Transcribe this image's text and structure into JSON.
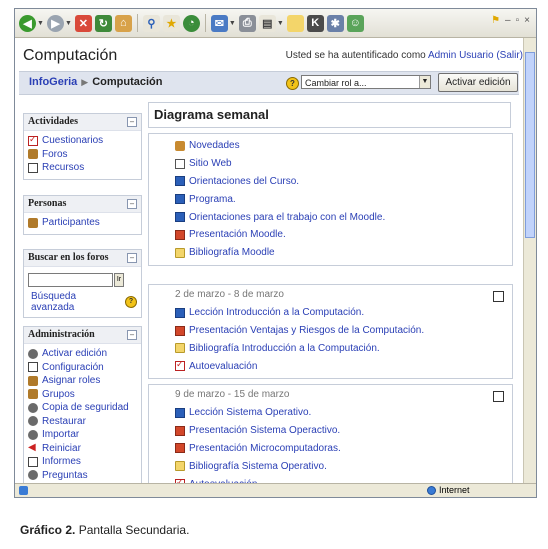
{
  "course": {
    "title": "Computación"
  },
  "login": {
    "prefix": "Usted se ha autentificado como",
    "user": "Admin Usuario",
    "logout": "(Salir)"
  },
  "breadcrumb": {
    "home": "InfoGeria",
    "current": "Computación"
  },
  "role_select": {
    "value": "Cambiar rol a..."
  },
  "edit_button": {
    "label": "Activar edición"
  },
  "blocks": {
    "activities": {
      "title": "Actividades",
      "items": [
        "Cuestionarios",
        "Foros",
        "Recursos"
      ]
    },
    "people": {
      "title": "Personas",
      "items": [
        "Participantes"
      ]
    },
    "search": {
      "title": "Buscar en los foros",
      "go": "Ir",
      "advanced": "Búsqueda avanzada"
    },
    "admin": {
      "title": "Administración",
      "items": [
        "Activar edición",
        "Configuración",
        "Asignar roles",
        "Grupos",
        "Copia de seguridad",
        "Restaurar",
        "Importar",
        "Reiniciar",
        "Informes",
        "Preguntas"
      ]
    }
  },
  "main": {
    "title": "Diagrama semanal",
    "sections": [
      {
        "date": "",
        "items": [
          {
            "icon": "news-icon",
            "label": "Novedades"
          },
          {
            "icon": "web-icon",
            "label": "Sitio Web"
          },
          {
            "icon": "word-icon",
            "label": "Orientaciones del Curso."
          },
          {
            "icon": "word-icon",
            "label": "Programa."
          },
          {
            "icon": "word-icon",
            "label": "Orientaciones para el trabajo con el Moodle."
          },
          {
            "icon": "ppt-icon",
            "label": "Presentación Moodle."
          },
          {
            "icon": "folder-icon",
            "label": "Bibliografía Moodle"
          }
        ]
      },
      {
        "date": "2 de marzo - 8 de marzo",
        "items": [
          {
            "icon": "word-icon",
            "label": "Lección Introducción a la Computación."
          },
          {
            "icon": "ppt-icon",
            "label": "Presentación Ventajas y Riesgos de la Computación."
          },
          {
            "icon": "folder-icon",
            "label": "Bibliografía Introducción a la Computación."
          },
          {
            "icon": "quiz-icon",
            "label": "Autoevaluación"
          }
        ]
      },
      {
        "date": "9 de marzo - 15 de marzo",
        "items": [
          {
            "icon": "word-icon",
            "label": "Lección Sistema Operativo."
          },
          {
            "icon": "ppt-icon",
            "label": "Presentación Sistema Operactivo."
          },
          {
            "icon": "ppt-icon",
            "label": "Presentación Microcomputadoras."
          },
          {
            "icon": "folder-icon",
            "label": "Bibliografía Sistema Operativo."
          },
          {
            "icon": "quiz-icon",
            "label": "Autoevaluación."
          }
        ]
      }
    ]
  },
  "status": {
    "zone": "Internet"
  },
  "caption": {
    "label": "Gráfico 2.",
    "text": " Pantalla Secundaria."
  }
}
